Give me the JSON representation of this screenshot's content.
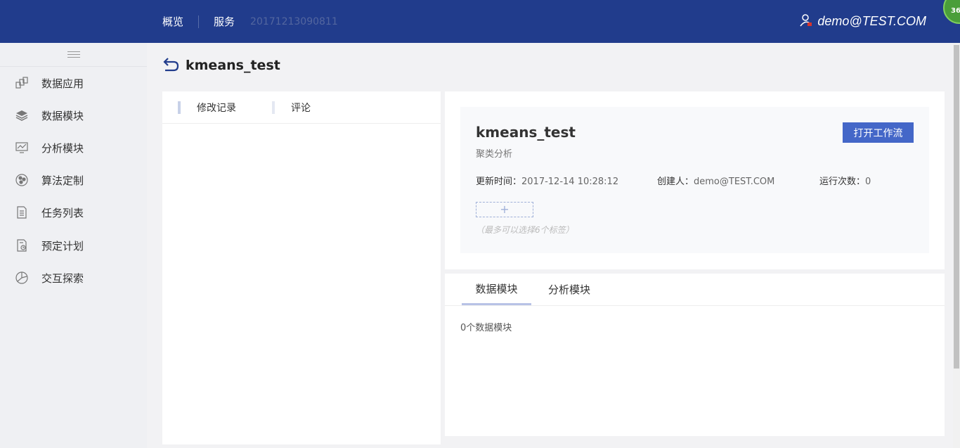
{
  "topbar": {
    "nav": [
      {
        "label": "概览"
      },
      {
        "label": "服务"
      }
    ],
    "service_id": "20171213090811",
    "user": "demo@TEST.COM",
    "badge": "36"
  },
  "sidebar": {
    "items": [
      {
        "label": "数据应用",
        "icon": "data-app-icon"
      },
      {
        "label": "数据模块",
        "icon": "layers-icon"
      },
      {
        "label": "分析模块",
        "icon": "monitor-chart-icon"
      },
      {
        "label": "算法定制",
        "icon": "circles-icon"
      },
      {
        "label": "任务列表",
        "icon": "list-doc-icon"
      },
      {
        "label": "预定计划",
        "icon": "schedule-doc-icon"
      },
      {
        "label": "交互探索",
        "icon": "explore-icon"
      }
    ]
  },
  "page": {
    "title": "kmeans_test"
  },
  "left_panel": {
    "tabs": [
      {
        "label": "修改记录"
      },
      {
        "label": "评论"
      }
    ]
  },
  "card": {
    "title": "kmeans_test",
    "subtitle": "聚类分析",
    "open_button": "打开工作流",
    "meta": [
      {
        "label": "更新时间：",
        "value": "2017-12-14 10:28:12"
      },
      {
        "label": "创建人：",
        "value": "demo@TEST.COM"
      },
      {
        "label": "运行次数：",
        "value": "0"
      }
    ],
    "tag_add": "+",
    "tag_hint": "（最多可以选择6个标签）"
  },
  "modules": {
    "tabs": [
      {
        "label": "数据模块",
        "active": true
      },
      {
        "label": "分析模块",
        "active": false
      }
    ],
    "count_text": "0个数据模块"
  },
  "colors": {
    "topbar": "#213c8c",
    "primary_button": "#4467c8"
  }
}
